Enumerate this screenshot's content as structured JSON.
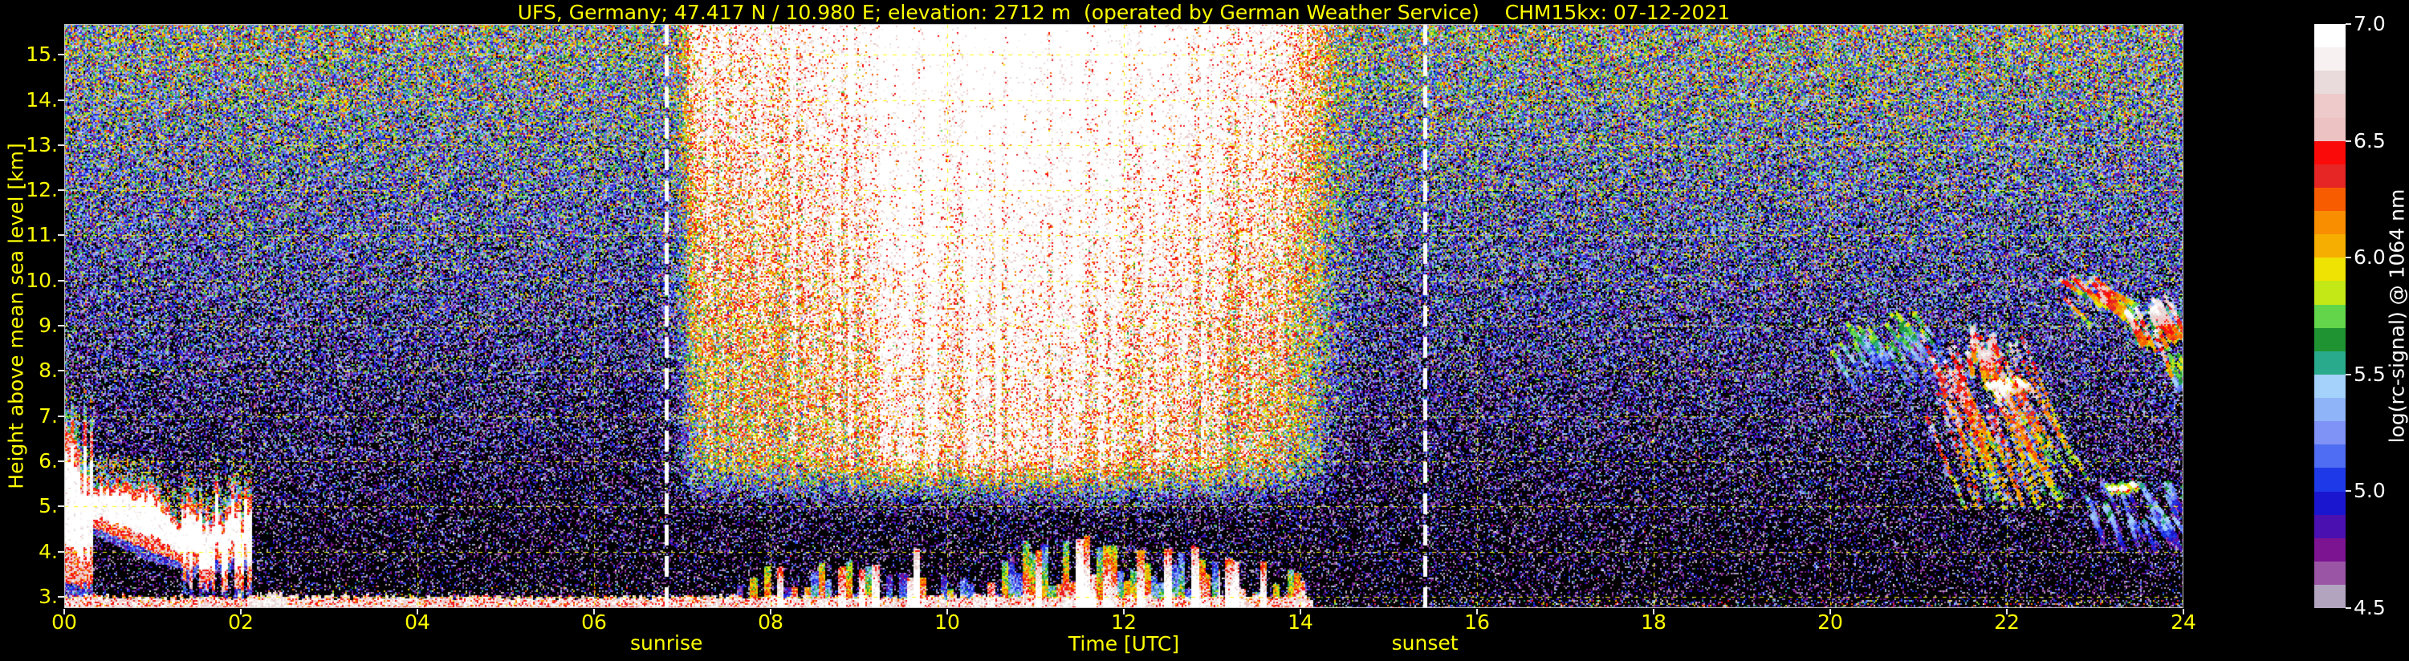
{
  "title": "UFS, Germany; 47.417 N / 10.980 E; elevation: 2712 m  (operated by German Weather Service)    CHM15kx: 07-12-2021",
  "figure": {
    "background": "#000000",
    "axis_text_color": "#ffff00",
    "colorbar_text_color": "#ffffff",
    "grid_color": "#ffff00",
    "frame_color": "#c8c8c8",
    "twilight_line_color": "#ffffff"
  },
  "chart_data": {
    "type": "heatmap",
    "instrument": "CHM15kx ceilometer",
    "date_label": "07-12-2021",
    "station_label": "UFS, Germany",
    "xlabel": "Time [UTC]",
    "ylabel": "Height above mean sea level [km]",
    "x_range_hours": [
      0,
      24
    ],
    "y_range_km": [
      2.75,
      15.68
    ],
    "grid": "yellow dashed lines every 2 hours and every 1 km",
    "x_ticks": [
      {
        "label": "00",
        "hour": 0
      },
      {
        "label": "02",
        "hour": 2
      },
      {
        "label": "04",
        "hour": 4
      },
      {
        "label": "06",
        "hour": 6
      },
      {
        "label": "08",
        "hour": 8
      },
      {
        "label": "10",
        "hour": 10
      },
      {
        "label": "12",
        "hour": 12
      },
      {
        "label": "14",
        "hour": 14
      },
      {
        "label": "16",
        "hour": 16
      },
      {
        "label": "18",
        "hour": 18
      },
      {
        "label": "20",
        "hour": 20
      },
      {
        "label": "22",
        "hour": 22
      },
      {
        "label": "24",
        "hour": 24
      }
    ],
    "y_ticks": [
      {
        "label": "15.",
        "km": 15
      },
      {
        "label": "14.",
        "km": 14
      },
      {
        "label": "13.",
        "km": 13
      },
      {
        "label": "12.",
        "km": 12
      },
      {
        "label": "11.",
        "km": 11
      },
      {
        "label": "10.",
        "km": 10
      },
      {
        "label": "9.",
        "km": 9
      },
      {
        "label": "8.",
        "km": 8
      },
      {
        "label": "7.",
        "km": 7
      },
      {
        "label": "6.",
        "km": 6
      },
      {
        "label": "5.",
        "km": 5
      },
      {
        "label": "4.",
        "km": 4
      },
      {
        "label": "3.",
        "km": 3
      }
    ],
    "annotations": [
      {
        "text": "sunrise",
        "hour": 6.82,
        "line": "white dashed vertical"
      },
      {
        "text": "sunset",
        "hour": 15.41,
        "line": "white dashed vertical"
      }
    ],
    "colorbar": {
      "label": "log(rc-signal) @ 1064 nm",
      "range": [
        4.5,
        7.0
      ],
      "ticks": [
        {
          "label": "7.0",
          "value": 7.0
        },
        {
          "label": "6.5",
          "value": 6.5
        },
        {
          "label": "6.0",
          "value": 6.0
        },
        {
          "label": "5.5",
          "value": 5.5
        },
        {
          "label": "5.0",
          "value": 5.0
        },
        {
          "label": "4.5",
          "value": 4.5
        }
      ],
      "colors_top_to_bottom": [
        "#ffffff",
        "#f7f1f1",
        "#e9dbdb",
        "#eecaca",
        "#edc2c2",
        "#fb0a0a",
        "#e62525",
        "#f85c00",
        "#f98e00",
        "#f6ae00",
        "#efe303",
        "#c3e816",
        "#62d54a",
        "#1f9331",
        "#2aaa8c",
        "#a4d2fa",
        "#8fb4f8",
        "#7f92f6",
        "#4f6df3",
        "#1e3ae8",
        "#1a16cf",
        "#4a10b0",
        "#7c1390",
        "#9b55a5",
        "#b2a4bf"
      ]
    },
    "phenomena": {
      "night_noise": {
        "base_level_at_3km": 4.05,
        "gain_per_km": 0.118,
        "speckle_sd": 0.55
      },
      "daylight_noise": {
        "start_hour": 6.85,
        "ramp_hours": 0.4,
        "fade_start_hour": 13.6,
        "fade_hours": 1.2,
        "peak_hour": 10.9,
        "max_boost": 2.55,
        "bottom_km": 4.65,
        "full_km": 6.25
      },
      "residual_aerosol_layer": {
        "hours": [
          0,
          2.1
        ],
        "top_km_max": 7.3,
        "top_km_typ": 5.6,
        "end_cut_hour": 2.12,
        "white_core": true
      },
      "surface_aerosol_line": {
        "hours": [
          0,
          14.15
        ],
        "top_km": 2.95
      },
      "detached_low_cloud": {
        "hours": [
          2.08,
          2.52
        ],
        "top_km": 3.1
      },
      "convective_plumes": {
        "hours": [
          7.55,
          14.05
        ],
        "top_km_max": 4.4,
        "peak_hour": 11.2
      },
      "cirrus_clusters": [
        {
          "t": [
            20.0,
            21.15
          ],
          "h": [
            7.6,
            9.3
          ],
          "n": 22,
          "amp": 5.7,
          "len": 0.3,
          "drop": 0.8
        },
        {
          "t": [
            20.85,
            22.35
          ],
          "h": [
            5.2,
            9.0
          ],
          "n": 40,
          "amp": 6.6,
          "len": 0.55,
          "drop": 2.6
        },
        {
          "t": [
            21.45,
            21.85
          ],
          "h": [
            7.9,
            8.95
          ],
          "n": 10,
          "amp": 6.7,
          "len": 0.05,
          "drop": 0.55
        },
        {
          "t": [
            21.78,
            22.2
          ],
          "h": [
            7.1,
            7.85
          ],
          "n": 12,
          "amp": 7.2,
          "len": 0.07,
          "drop": 0.15
        },
        {
          "t": [
            22.5,
            23.15
          ],
          "h": [
            9.1,
            10.15
          ],
          "n": 16,
          "amp": 6.5,
          "len": 0.3,
          "drop": 0.5
        },
        {
          "t": [
            23.35,
            23.95
          ],
          "h": [
            8.1,
            9.7
          ],
          "n": 14,
          "amp": 6.8,
          "len": 0.2,
          "drop": 0.9
        },
        {
          "t": [
            23.8,
            24.0
          ],
          "h": [
            7.4,
            8.7
          ],
          "n": 8,
          "amp": 5.8,
          "len": 0.15,
          "drop": 0.6
        },
        {
          "t": [
            22.85,
            24.0
          ],
          "h": [
            3.8,
            5.6
          ],
          "n": 30,
          "amp": 5.4,
          "len": 0.15,
          "drop": 0.6
        },
        {
          "t": [
            23.15,
            23.45
          ],
          "h": [
            5.3,
            5.5
          ],
          "n": 6,
          "amp": 7.1,
          "len": 0.05,
          "drop": 0.05
        }
      ]
    }
  }
}
